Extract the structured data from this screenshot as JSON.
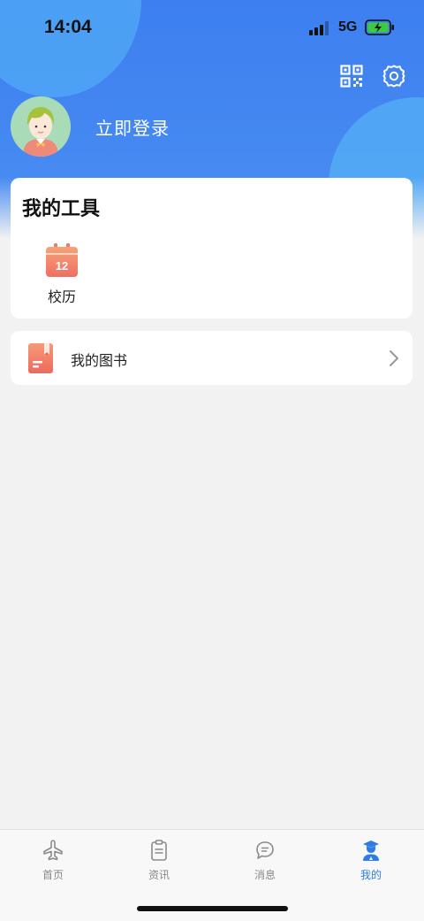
{
  "status_bar": {
    "time": "14:04",
    "network": "5G"
  },
  "header": {
    "qr_icon": "qr-code-icon",
    "settings_icon": "gear-icon",
    "login_label": "立即登录",
    "accent": "#3d7ff0"
  },
  "tools": {
    "title": "我的工具",
    "items": [
      {
        "label": "校历",
        "icon": "calendar-icon",
        "icon_text": "12"
      }
    ]
  },
  "books": {
    "label": "我的图书",
    "icon": "book-icon"
  },
  "tabbar": {
    "active_color": "#2e7de6",
    "items": [
      {
        "label": "首页",
        "icon": "airplane-icon"
      },
      {
        "label": "资讯",
        "icon": "clipboard-icon"
      },
      {
        "label": "消息",
        "icon": "chat-bubble-icon"
      },
      {
        "label": "我的",
        "icon": "graduate-user-icon",
        "active": true
      }
    ]
  }
}
